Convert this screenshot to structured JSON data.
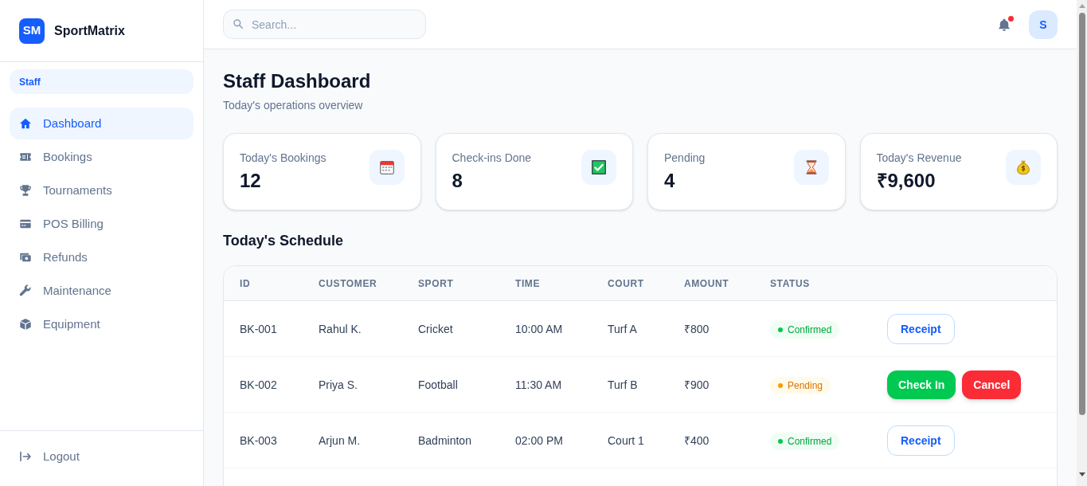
{
  "sidebar": {
    "logo": {
      "initials": "SM",
      "name": "SportMatrix"
    },
    "role_badge": "Staff",
    "items": [
      {
        "label": "Dashboard",
        "selected": true
      },
      {
        "label": "Bookings",
        "selected": false
      },
      {
        "label": "Tournaments",
        "selected": false
      },
      {
        "label": "POS Billing",
        "selected": false
      },
      {
        "label": "Refunds",
        "selected": false
      },
      {
        "label": "Maintenance",
        "selected": false
      },
      {
        "label": "Equipment",
        "selected": false
      }
    ],
    "logout": "Logout"
  },
  "topbar": {
    "search": {
      "placeholder": "Search..."
    },
    "notifications": {
      "unread": true
    },
    "avatar": "S"
  },
  "header": {
    "title": "Staff Dashboard",
    "subtitle": "Today's operations overview"
  },
  "stats": [
    {
      "label": "Today's Bookings",
      "value": "12"
    },
    {
      "label": "Check-ins Done",
      "value": "8"
    },
    {
      "label": "Pending",
      "value": "4"
    },
    {
      "label": "Today's Revenue",
      "value": "₹9,600"
    }
  ],
  "schedule": {
    "title": "Today's Schedule",
    "columns": [
      "ID",
      "CUSTOMER",
      "SPORT",
      "TIME",
      "COURT",
      "AMOUNT",
      "STATUS"
    ],
    "rows": [
      {
        "cells": [
          "BK-001",
          "Rahul K.",
          "Cricket",
          "10:00 AM",
          "Turf A",
          "₹800"
        ],
        "status": {
          "label": "Confirmed",
          "kind": "confirmed"
        },
        "actions": [
          {
            "label": "Receipt",
            "kind": "outline"
          }
        ]
      },
      {
        "cells": [
          "BK-002",
          "Priya S.",
          "Football",
          "11:30 AM",
          "Turf B",
          "₹900"
        ],
        "status": {
          "label": "Pending",
          "kind": "pending"
        },
        "actions": [
          {
            "label": "Check In",
            "kind": "success"
          },
          {
            "label": "Cancel",
            "kind": "danger"
          }
        ]
      },
      {
        "cells": [
          "BK-003",
          "Arjun M.",
          "Badminton",
          "02:00 PM",
          "Court 1",
          "₹400"
        ],
        "status": {
          "label": "Confirmed",
          "kind": "confirmed"
        },
        "actions": [
          {
            "label": "Receipt",
            "kind": "outline"
          }
        ]
      }
    ]
  }
}
